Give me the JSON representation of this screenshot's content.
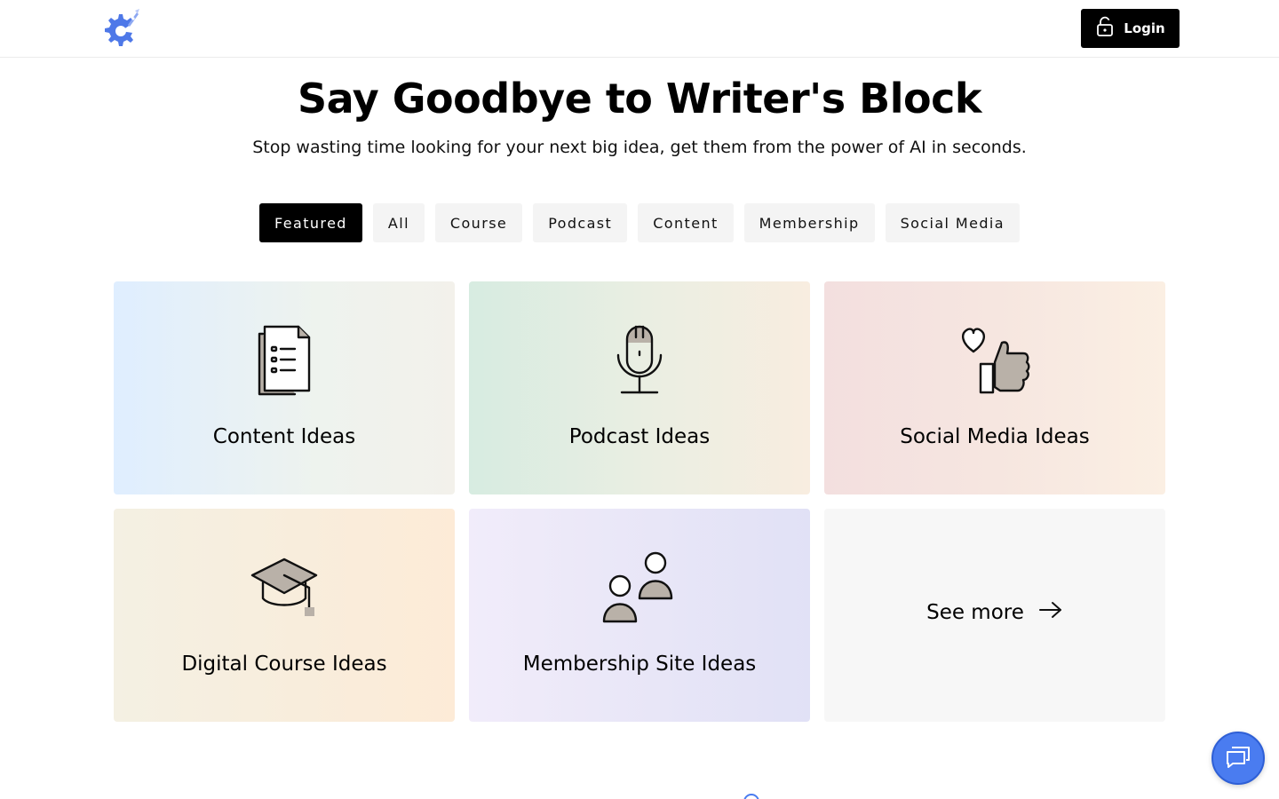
{
  "header": {
    "logo_icon": "gear-rocket-logo-icon",
    "login_label": "Login",
    "login_icon": "unlock-icon"
  },
  "hero": {
    "title": "Say Goodbye to Writer's Block",
    "subtitle": "Stop wasting time looking for your next big idea, get them from the power of AI in seconds."
  },
  "tabs": [
    {
      "label": "Featured",
      "active": true
    },
    {
      "label": "All",
      "active": false
    },
    {
      "label": "Course",
      "active": false
    },
    {
      "label": "Podcast",
      "active": false
    },
    {
      "label": "Content",
      "active": false
    },
    {
      "label": "Membership",
      "active": false
    },
    {
      "label": "Social Media",
      "active": false
    }
  ],
  "cards": [
    {
      "label": "Content Ideas",
      "icon": "document-list-icon"
    },
    {
      "label": "Podcast Ideas",
      "icon": "microphone-icon"
    },
    {
      "label": "Social Media Ideas",
      "icon": "thumbs-up-heart-icon"
    },
    {
      "label": "Digital Course Ideas",
      "icon": "graduation-cap-icon"
    },
    {
      "label": "Membership Site Ideas",
      "icon": "users-icon"
    }
  ],
  "see_more": {
    "label": "See more",
    "icon": "arrow-right-icon"
  },
  "chat": {
    "icon": "chat-bubbles-icon"
  },
  "colors": {
    "accent": "#4a7cf0",
    "logo_blue": "#4e78e8",
    "active_tab": "#000000",
    "icon_fill": "#b9b1a8"
  }
}
